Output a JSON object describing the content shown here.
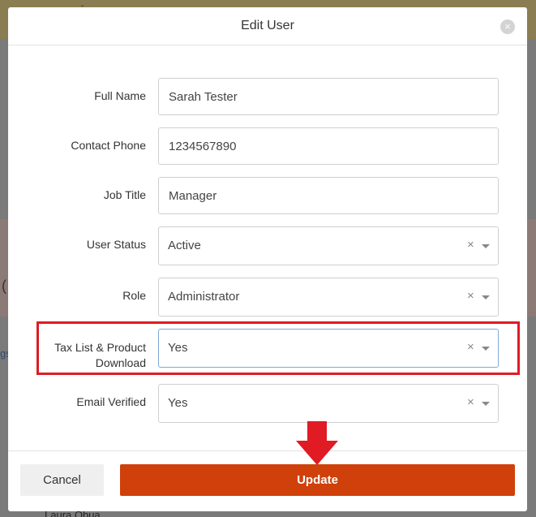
{
  "modal": {
    "title": "Edit User",
    "close_symbol": "×"
  },
  "form": {
    "full_name": {
      "label": "Full Name",
      "value": "Sarah Tester"
    },
    "contact_phone": {
      "label": "Contact Phone",
      "value": "1234567890"
    },
    "job_title": {
      "label": "Job Title",
      "value": "Manager"
    },
    "user_status": {
      "label": "User Status",
      "value": "Active"
    },
    "role": {
      "label": "Role",
      "value": "Administrator"
    },
    "tax_list_download": {
      "label_line1": "Tax List & Product",
      "label_line2": "Download",
      "value": "Yes"
    },
    "email_verified": {
      "label": "Email Verified",
      "value": "Yes"
    },
    "clear_symbol": "×"
  },
  "footer": {
    "cancel_label": "Cancel",
    "update_label": "Update"
  },
  "annotation": {
    "highlight_color": "#e01b24",
    "arrow_color": "#e01b24",
    "arrow_icon": "arrow-down-icon"
  },
  "background": {
    "left_fragment": "gs",
    "bottom_fragment": "Laura Obua"
  },
  "colors": {
    "primary_button": "#d0400a",
    "focus_border": "#7ea8d6"
  }
}
